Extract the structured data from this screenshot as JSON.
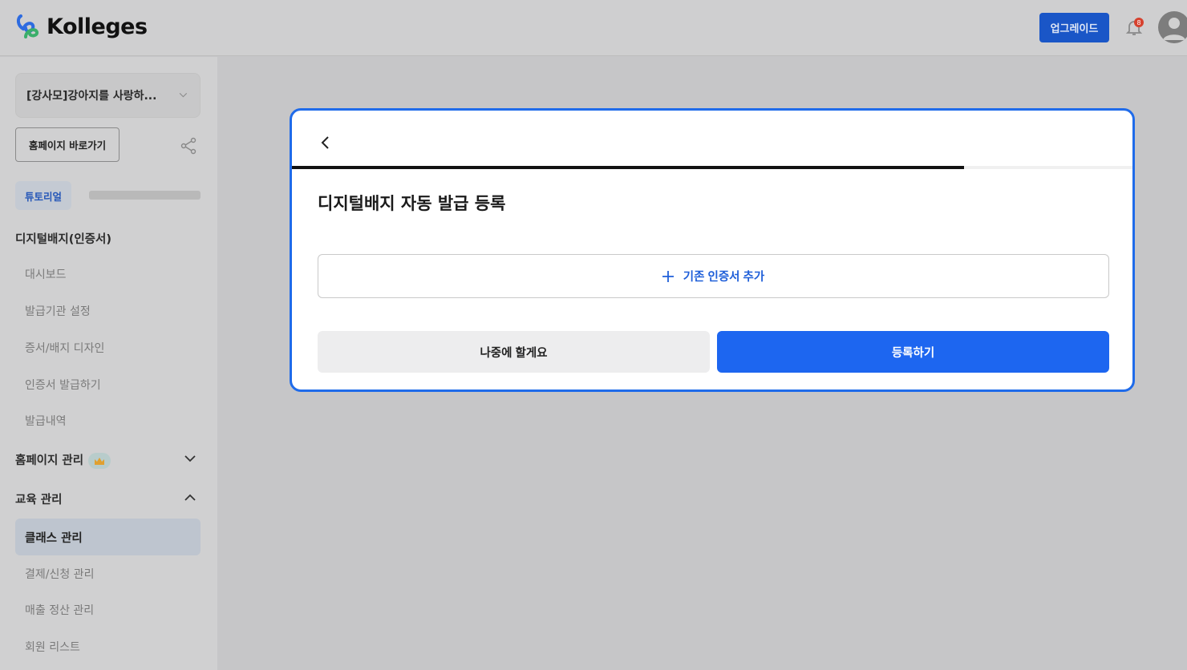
{
  "header": {
    "brand": "Kolleges",
    "upgrade_label": "업그레이드",
    "notification_count": "8"
  },
  "sidebar": {
    "org_name": "[강사모]강아지를 사랑하...",
    "homepage_button": "홈페이지 바로가기",
    "tutorial_label": "튜토리얼",
    "tutorial_progress": 0,
    "sections": [
      {
        "label": "디지털배지(인증서)",
        "items": [
          "대시보드",
          "발급기관 설정",
          "증서/배지 디자인",
          "인증서 발급하기",
          "발급내역"
        ]
      },
      {
        "label": "홈페이지 관리",
        "expanded": false
      },
      {
        "label": "교육 관리",
        "expanded": true,
        "items": [
          "클래스 관리",
          "결제/신청 관리",
          "매출 정산 관리",
          "회원 리스트"
        ],
        "active": "클래스 관리"
      }
    ]
  },
  "modal": {
    "progress_percent": 80,
    "title": "디지털배지 자동 발급 등록",
    "add_label": "기존 인증서 추가",
    "later_label": "나중에 할게요",
    "register_label": "등록하기"
  },
  "colors": {
    "accent": "#1d66f0",
    "modal_border": "#1f6bea"
  }
}
